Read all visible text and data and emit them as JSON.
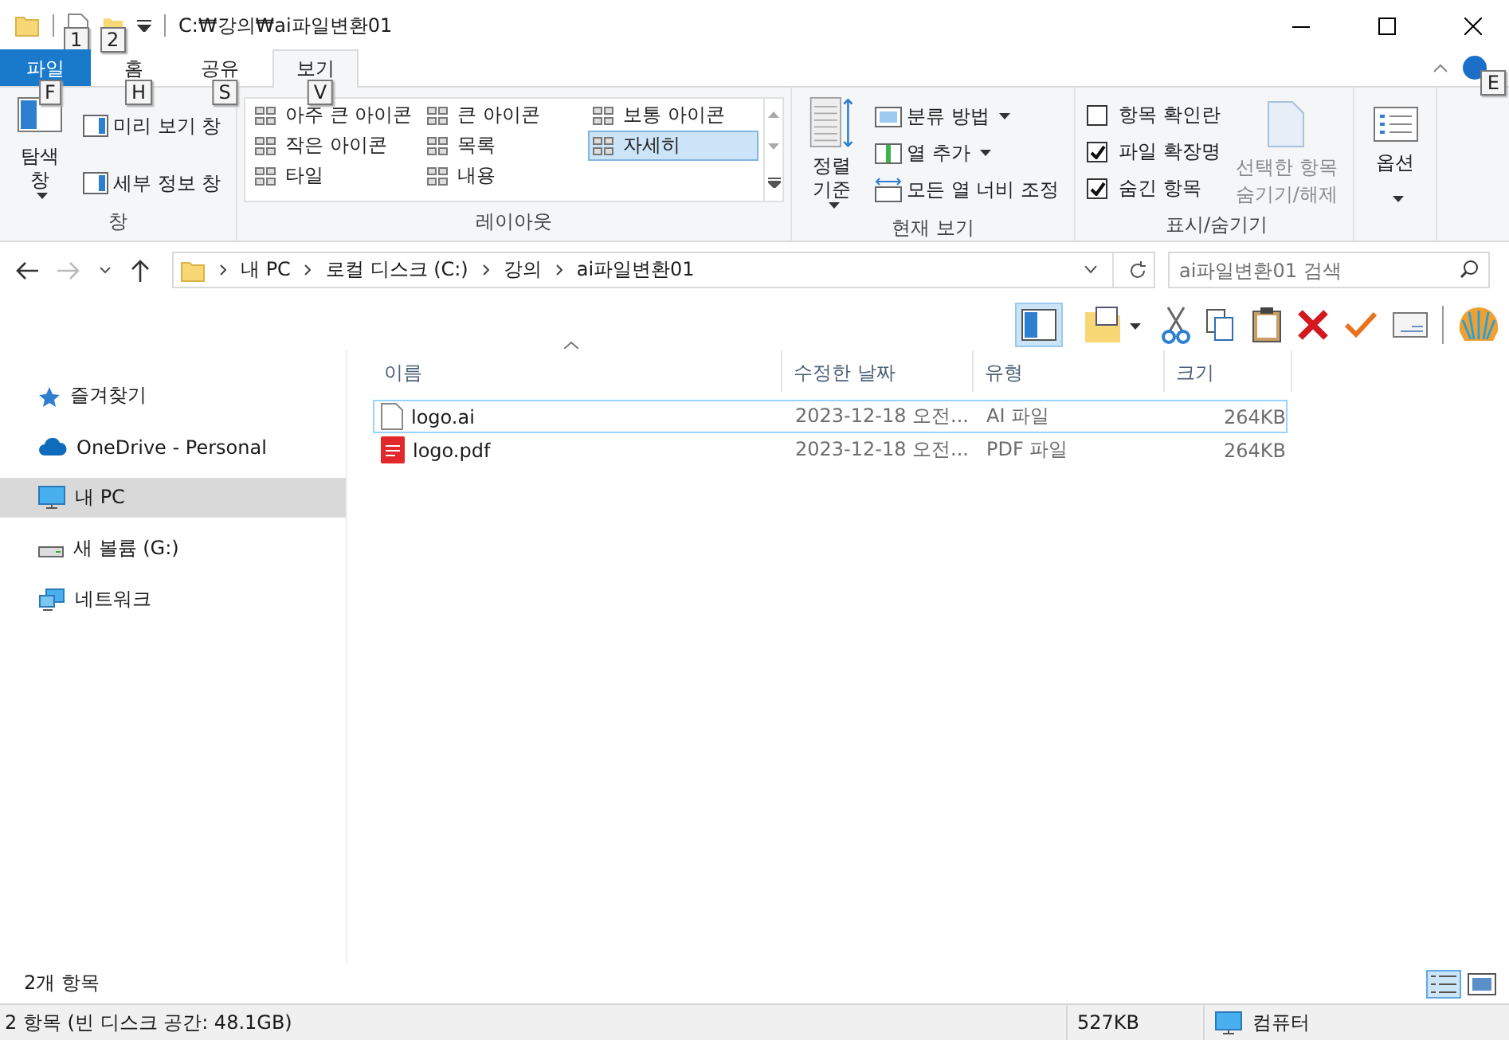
{
  "title_bar": {
    "path": "C:₩강의₩ai파일변환01",
    "quick_access_keytips": [
      "1",
      "2"
    ]
  },
  "ribbon": {
    "tabs": [
      {
        "label": "파일",
        "keytip": "F",
        "selected": false,
        "kind": "file"
      },
      {
        "label": "홈",
        "keytip": "H",
        "selected": false,
        "kind": "normal"
      },
      {
        "label": "공유",
        "keytip": "S",
        "selected": false,
        "kind": "normal"
      },
      {
        "label": "보기",
        "keytip": "V",
        "selected": true,
        "kind": "normal"
      }
    ],
    "help_keytip": "E",
    "pane_group": {
      "label": "창",
      "navigation_pane": "탐색 창",
      "preview_pane": "미리 보기 창",
      "details_pane": "세부 정보 창"
    },
    "layout_group": {
      "label": "레이아웃",
      "options": [
        {
          "label": "아주 큰 아이콘",
          "selected": false
        },
        {
          "label": "큰 아이콘",
          "selected": false
        },
        {
          "label": "보통 아이콘",
          "selected": false
        },
        {
          "label": "작은 아이콘",
          "selected": false
        },
        {
          "label": "목록",
          "selected": false
        },
        {
          "label": "자세히",
          "selected": true
        },
        {
          "label": "타일",
          "selected": false
        },
        {
          "label": "내용",
          "selected": false
        }
      ]
    },
    "current_view_group": {
      "label": "현재 보기",
      "sort_by": "정렬 기준",
      "group_by": "분류 방법",
      "add_columns": "열 추가",
      "size_columns": "모든 열 너비 조정"
    },
    "show_hide_group": {
      "label": "표시/숨기기",
      "checkboxes": [
        {
          "label": "항목 확인란",
          "checked": false
        },
        {
          "label": "파일 확장명",
          "checked": true
        },
        {
          "label": "숨긴 항목",
          "checked": true
        }
      ],
      "hide_selected": {
        "label": "선택한 항목 숨기기/해제",
        "disabled": true
      }
    },
    "options_label": "옵션"
  },
  "address_bar": {
    "breadcrumbs": [
      "내 PC",
      "로컬 디스크 (C:)",
      "강의",
      "ai파일변환01"
    ],
    "search": {
      "placeholder": "ai파일변환01 검색"
    }
  },
  "sidebar": {
    "items": [
      {
        "label": "즐겨찾기",
        "kind": "star",
        "selected": false
      },
      {
        "label": "OneDrive - Personal",
        "kind": "cloud",
        "selected": false
      },
      {
        "label": "내 PC",
        "kind": "pc",
        "selected": true
      },
      {
        "label": "새 볼륨 (G:)",
        "kind": "drive",
        "selected": false
      },
      {
        "label": "네트워크",
        "kind": "network",
        "selected": false
      }
    ]
  },
  "files": {
    "columns": [
      "이름",
      "수정한 날짜",
      "유형",
      "크기"
    ],
    "rows": [
      {
        "kind": "blank",
        "name": "logo.ai",
        "date": "2023-12-18 오전...",
        "type": "AI 파일",
        "size": "264KB",
        "focused": true
      },
      {
        "kind": "pdf",
        "name": "logo.pdf",
        "date": "2023-12-18 오전...",
        "type": "PDF 파일",
        "size": "264KB",
        "focused": false
      }
    ]
  },
  "status": {
    "item_count": "2개 항목",
    "view_buttons": [
      {
        "kind": "details",
        "selected": true
      },
      {
        "kind": "large",
        "selected": false
      }
    ],
    "summary": "2 항목 (빈 디스크 공간: 48.1GB)",
    "size": "527KB",
    "location": "컴퓨터"
  }
}
